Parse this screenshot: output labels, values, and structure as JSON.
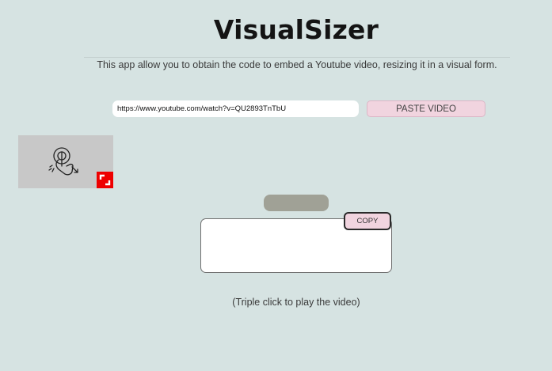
{
  "app": {
    "title": "VisualSizer",
    "subtitle": "This app allow you to obtain the code to embed a Youtube video, resizing it in a visual form."
  },
  "url_input": {
    "value": "https://www.youtube.com/watch?v=QU2893TnTbU",
    "placeholder": ""
  },
  "paste_button": {
    "label": "PASTE VIDEO"
  },
  "video": {
    "icon": "triple-tap-gesture-icon",
    "handle_icon": "resize-handle-icon",
    "handle_color": "#ee0000"
  },
  "size_display": {
    "text": ""
  },
  "code_output": {
    "value": ""
  },
  "copy_button": {
    "label": "COPY"
  },
  "hint": {
    "text": "(Triple click to play the video)"
  },
  "colors": {
    "background": "#d6e3e2",
    "button_pink": "#f1d4df",
    "pill_gray": "#a0a196"
  }
}
